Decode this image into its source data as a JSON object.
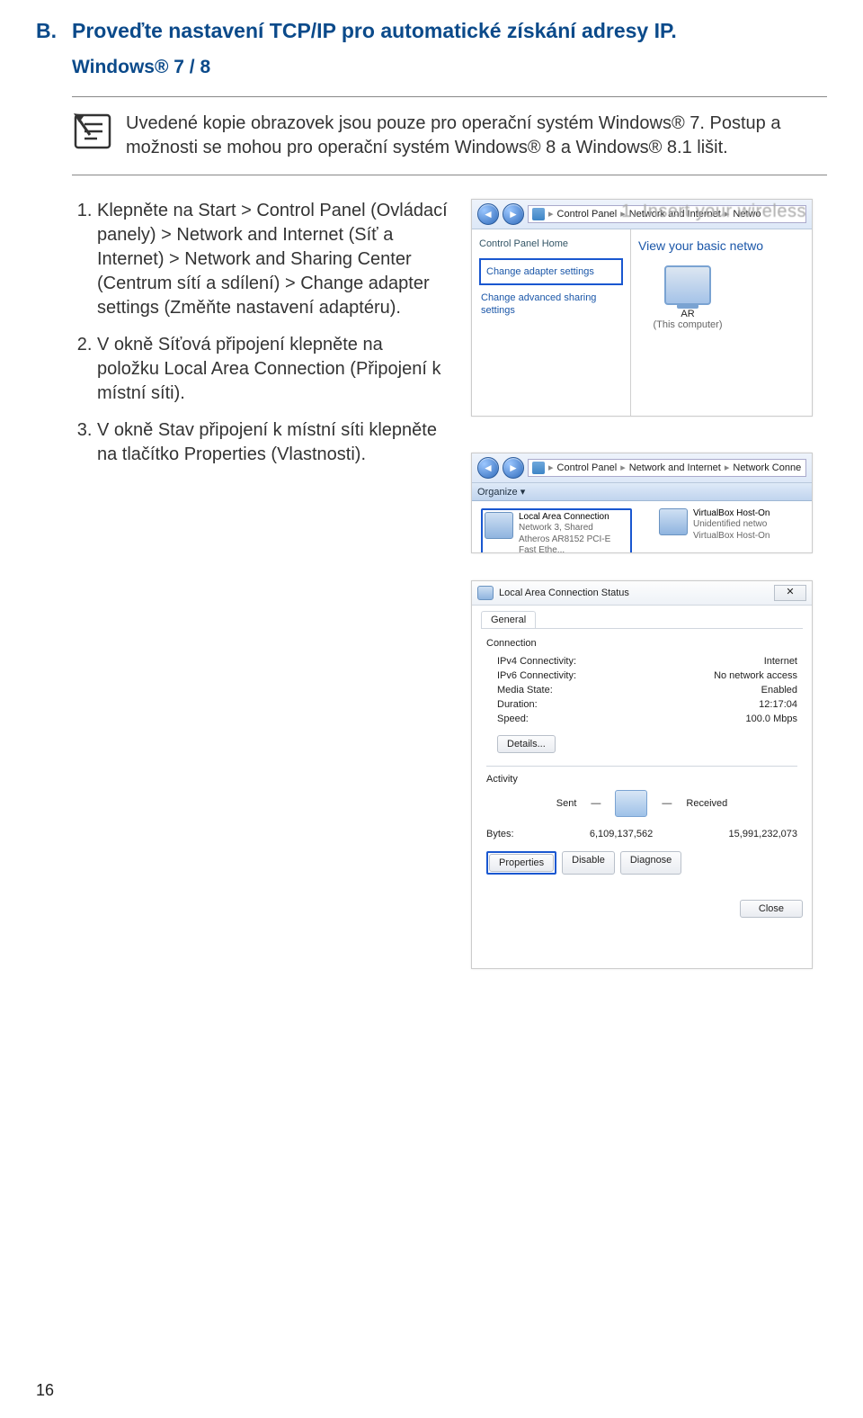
{
  "section": {
    "letter": "B.",
    "title": "Proveďte nastavení TCP/IP pro automatické získání adresy IP."
  },
  "subhead": "Windows® 7 / 8",
  "note": "Uvedené kopie obrazovek jsou pouze pro operační systém Windows® 7. Postup a možnosti se mohou pro operační systém Windows® 8 a Windows® 8.1 lišit.",
  "steps": {
    "s1": "Klepněte na Start > Control Panel (Ovládací panely) > Network and Internet (Síť a Internet) > Network and Sharing Center (Centrum sítí a sdílení) > Change adapter settings (Změňte nastavení adaptéru).",
    "s2": "V okně Síťová připojení klepněte na položku Local Area Connection (Připojení k místní síti).",
    "s3": "V okně Stav připojení k místní síti klepněte na tlačítko Properties (Vlastnosti)."
  },
  "shot1": {
    "ghost": "1. Insert your wireless",
    "bc1": "Control Panel",
    "bc2": "Network and Internet",
    "bc3": "Netwo",
    "home": "Control Panel Home",
    "link1": "Change adapter settings",
    "link2": "Change advanced sharing settings",
    "rightTitle": "View your basic netwo",
    "pcName": "AR",
    "pcSub": "(This computer)"
  },
  "shot2": {
    "bc1": "Control Panel",
    "bc2": "Network and Internet",
    "bc3": "Network Conne",
    "organize": "Organize ▾",
    "lac": {
      "title": "Local Area Connection",
      "sub1": "Network 3, Shared",
      "sub2": "Atheros AR8152 PCI-E Fast Ethe..."
    },
    "vb": {
      "title": "VirtualBox Host-On",
      "sub1": "Unidentified netwo",
      "sub2": "VirtualBox Host-On"
    }
  },
  "shot3": {
    "title": "Local Area Connection Status",
    "tab": "General",
    "connHdr": "Connection",
    "rows": {
      "ipv4k": "IPv4 Connectivity:",
      "ipv4v": "Internet",
      "ipv6k": "IPv6 Connectivity:",
      "ipv6v": "No network access",
      "mediak": "Media State:",
      "mediav": "Enabled",
      "durk": "Duration:",
      "durv": "12:17:04",
      "spdk": "Speed:",
      "spdv": "100.0 Mbps"
    },
    "details": "Details...",
    "activityHdr": "Activity",
    "sent": "Sent",
    "recv": "Received",
    "bytesLabel": "Bytes:",
    "bytesSent": "6,109,137,562",
    "bytesRecv": "15,991,232,073",
    "prop": "Properties",
    "disable": "Disable",
    "diag": "Diagnose",
    "close": "Close"
  },
  "pageNumber": "16"
}
